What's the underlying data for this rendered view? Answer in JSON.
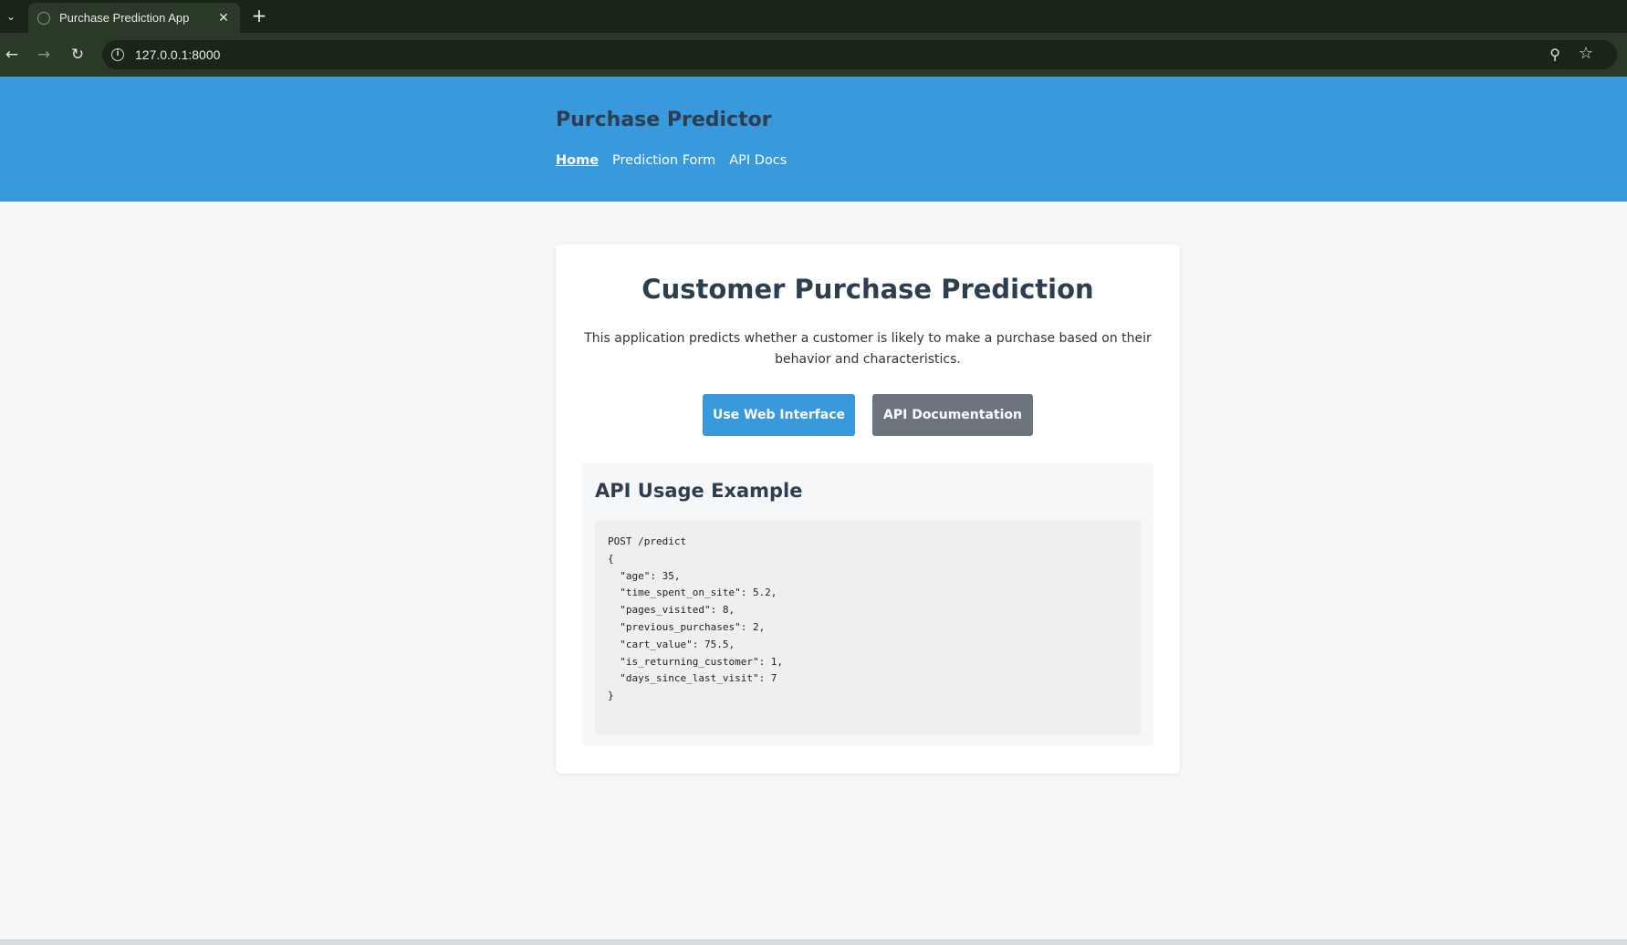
{
  "browser": {
    "tab_title": "Purchase Prediction App",
    "url": "127.0.0.1:8000",
    "icons": {
      "tab_list": "chevron-down-icon",
      "favicon": "globe-icon",
      "close": "close-icon",
      "new_tab": "plus-icon",
      "back": "back-arrow-icon",
      "forward": "forward-arrow-icon",
      "reload": "reload-icon",
      "info": "info-icon",
      "zoom": "zoom-icon",
      "bookmark": "star-icon"
    },
    "glyphs": {
      "tab_list": "⌄",
      "close": "✕",
      "new_tab": "+",
      "back": "←",
      "forward": "→",
      "reload": "↻",
      "info": "i",
      "zoom": "⚲",
      "bookmark": "☆"
    }
  },
  "header": {
    "brand": "Purchase Predictor",
    "nav": [
      {
        "label": "Home",
        "active": true
      },
      {
        "label": "Prediction Form",
        "active": false
      },
      {
        "label": "API Docs",
        "active": false
      }
    ]
  },
  "main": {
    "title": "Customer Purchase Prediction",
    "description": "This application predicts whether a customer is likely to make a purchase based on their behavior and characteristics.",
    "buttons": {
      "primary": "Use Web Interface",
      "secondary": "API Documentation"
    },
    "api_example": {
      "title": "API Usage Example",
      "code": "POST /predict\n{\n  \"age\": 35,\n  \"time_spent_on_site\": 5.2,\n  \"pages_visited\": 8,\n  \"previous_purchases\": 2,\n  \"cart_value\": 75.5,\n  \"is_returning_customer\": 1,\n  \"days_since_last_visit\": 7\n}"
    }
  },
  "colors": {
    "header_bg": "#3899dc",
    "primary_button": "#3899dc",
    "secondary_button": "#6c757d",
    "heading_text": "#2c3e50",
    "page_bg": "#f5f7f9"
  }
}
